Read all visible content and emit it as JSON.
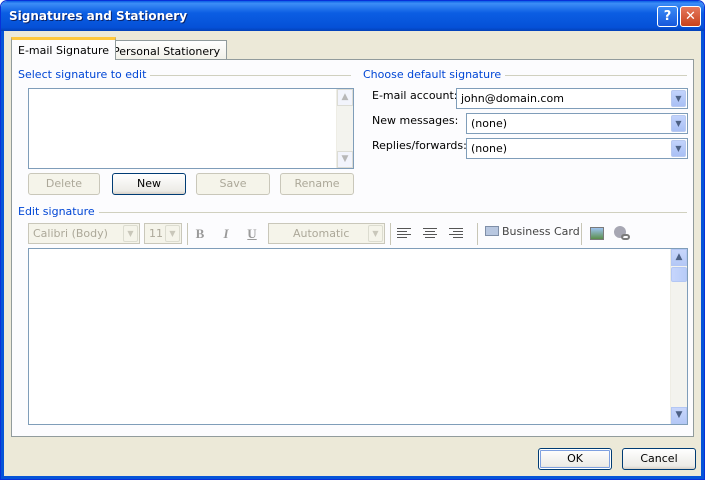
{
  "window": {
    "title": "Signatures and Stationery",
    "help_glyph": "?",
    "close_glyph": "✕"
  },
  "tabs": [
    {
      "label": "E-mail Signature",
      "active": true
    },
    {
      "label": "Personal Stationery",
      "active": false
    }
  ],
  "select_signature": {
    "label": "Select signature to edit",
    "buttons": {
      "delete": "Delete",
      "new": "New",
      "save": "Save",
      "rename": "Rename"
    }
  },
  "default_signature": {
    "label": "Choose default signature",
    "email_account": {
      "label": "E-mail account:",
      "value": "john@domain.com"
    },
    "new_messages": {
      "label": "New messages:",
      "value": "(none)"
    },
    "replies_forwards": {
      "label": "Replies/forwards:",
      "value": "(none)"
    }
  },
  "edit_signature": {
    "label": "Edit signature",
    "font": "Calibri (Body)",
    "size": "11",
    "bold": "B",
    "italic": "I",
    "underline": "U",
    "color": "Automatic",
    "business_card": "Business Card"
  },
  "footer": {
    "ok": "OK",
    "cancel": "Cancel"
  },
  "icons": {
    "arrow_up": "▲",
    "arrow_down": "▼",
    "combo_arrow": "▼"
  }
}
